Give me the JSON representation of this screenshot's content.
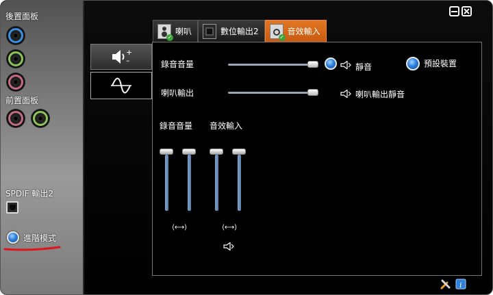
{
  "left_panel": {
    "rear_panel_label": "後置面板",
    "front_panel_label": "前置面板",
    "spdif_label": "SPDIF 輸出2",
    "advanced_mode_label": "進階模式"
  },
  "tabs": [
    {
      "label": "喇叭"
    },
    {
      "label": "數位輸出2"
    },
    {
      "label": "音效輸入"
    }
  ],
  "main": {
    "rec_volume_label": "錄音音量",
    "mute_label": "靜音",
    "default_device_label": "預設裝置",
    "speaker_out_label": "喇叭輸出",
    "speaker_out_mute_label": "喇叭輸出靜音",
    "group1_label": "錄音音量",
    "group2_label": "音效輸入",
    "link_icon_text": "⟨⟷⟩"
  },
  "values": {
    "rec_volume": 0.95,
    "speaker_out": 0.95,
    "rec_left": 1.0,
    "rec_right": 1.0,
    "input_left": 1.0,
    "input_right": 1.0
  },
  "colors": {
    "active_tab": "#e27722",
    "accent_blue": "#2d7fd9",
    "slider_blue": "#6f93bf",
    "annotation_red": "#e0141c"
  }
}
